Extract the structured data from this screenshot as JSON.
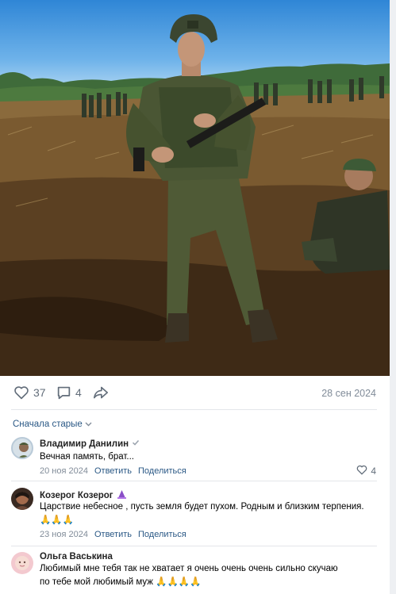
{
  "post": {
    "likes": "37",
    "comments": "4",
    "date": "28 сен 2024"
  },
  "comments_section": {
    "sort_label": "Сначала старые",
    "items": [
      {
        "author": "Владимир Данилин",
        "verified": true,
        "text": "Вечная память, брат...",
        "date": "20 ноя 2024",
        "reply_label": "Ответить",
        "share_label": "Поделиться",
        "likes": "4"
      },
      {
        "author": "Козерог Козерог",
        "text_line1": "Царствие небесное , пусть земля будет пухом. Родным и близким терпения.",
        "text_line2": "🙏🙏🙏",
        "date": "23 ноя 2024",
        "reply_label": "Ответить",
        "share_label": "Поделиться"
      },
      {
        "author": "Ольга Васькина",
        "text_line1": "Любимый мне тебя так не хватает я очень очень очень сильно скучаю",
        "text_line2": "по тебе мой любимый муж 🙏🙏🙏🙏"
      }
    ]
  },
  "colors": {
    "link": "#2a5885",
    "secondary": "#818c99",
    "icon": "#626d7a"
  }
}
